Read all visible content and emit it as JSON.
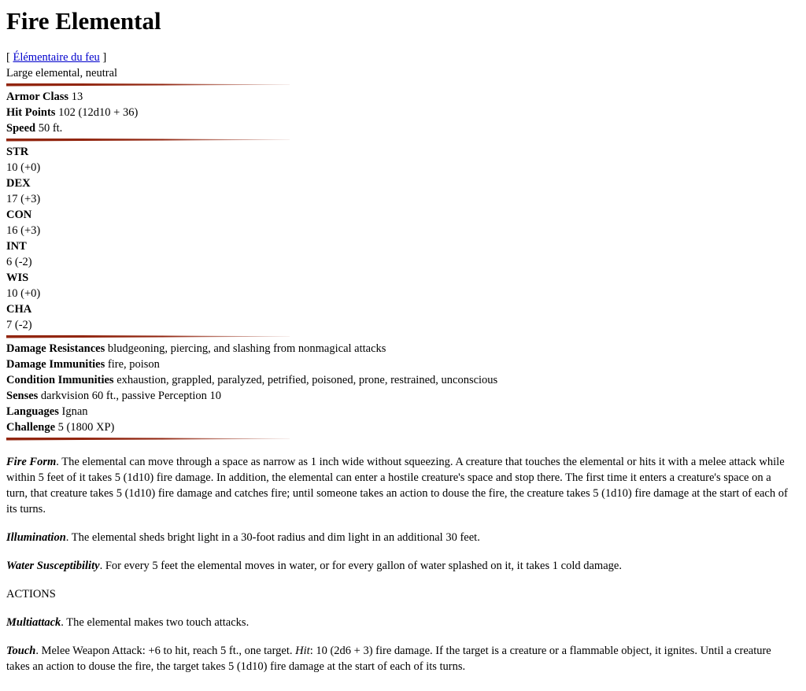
{
  "title": "Fire Elemental",
  "alt_name": {
    "open_bracket": "[ ",
    "link": "Élémentaire du feu",
    "close_bracket": " ]"
  },
  "type_line": "Large elemental, neutral",
  "defense": [
    {
      "label": "Armor Class",
      "value": "13"
    },
    {
      "label": "Hit Points",
      "value": "102 (12d10 + 36)"
    },
    {
      "label": "Speed",
      "value": "50 ft."
    }
  ],
  "abilities": [
    {
      "label": "STR",
      "value": "10 (+0)"
    },
    {
      "label": "DEX",
      "value": "17 (+3)"
    },
    {
      "label": "CON",
      "value": "16 (+3)"
    },
    {
      "label": "INT",
      "value": "6 (-2)"
    },
    {
      "label": "WIS",
      "value": "10 (+0)"
    },
    {
      "label": "CHA",
      "value": "7 (-2)"
    }
  ],
  "properties": [
    {
      "label": "Damage Resistances",
      "value": "bludgeoning, piercing, and slashing from nonmagical attacks"
    },
    {
      "label": "Damage Immunities",
      "value": "fire, poison"
    },
    {
      "label": "Condition Immunities",
      "value": "exhaustion, grappled, paralyzed, petrified, poisoned, prone, restrained, unconscious"
    },
    {
      "label": "Senses",
      "value": "darkvision 60 ft., passive Perception 10"
    },
    {
      "label": "Languages",
      "value": "Ignan"
    },
    {
      "label": "Challenge",
      "value": "5 (1800 XP)"
    }
  ],
  "traits": [
    {
      "name": "Fire Form",
      "text": ". The elemental can move through a space as narrow as 1 inch wide without squeezing. A creature that touches the elemental or hits it with a melee attack while within 5 feet of it takes 5 (1d10) fire damage. In addition, the elemental can enter a hostile creature's space and stop there. The first time it enters a creature's space on a turn, that creature takes 5 (1d10) fire damage and catches fire; until someone takes an action to douse the fire, the creature takes 5 (1d10) fire damage at the start of each of its turns."
    },
    {
      "name": "Illumination",
      "text": ". The elemental sheds bright light in a 30-foot radius and dim light in an additional 30 feet."
    },
    {
      "name": "Water Susceptibility",
      "text": ". For every 5 feet the elemental moves in water, or for every gallon of water splashed on it, it takes 1 cold damage."
    }
  ],
  "actions_heading": "ACTIONS",
  "multiattack": {
    "name": "Multiattack",
    "text": ". The elemental makes two touch attacks."
  },
  "touch": {
    "name": "Touch",
    "text_a": ". Melee Weapon Attack: +6 to hit, reach 5 ft., one target. ",
    "hit_label": "Hit",
    "text_b": ": 10 (2d6 + 3) fire damage. If the target is a creature or a flammable object, it ignites. Until a creature takes an action to douse the fire, the target takes 5 (1d10) fire damage at the start of each of its turns."
  }
}
